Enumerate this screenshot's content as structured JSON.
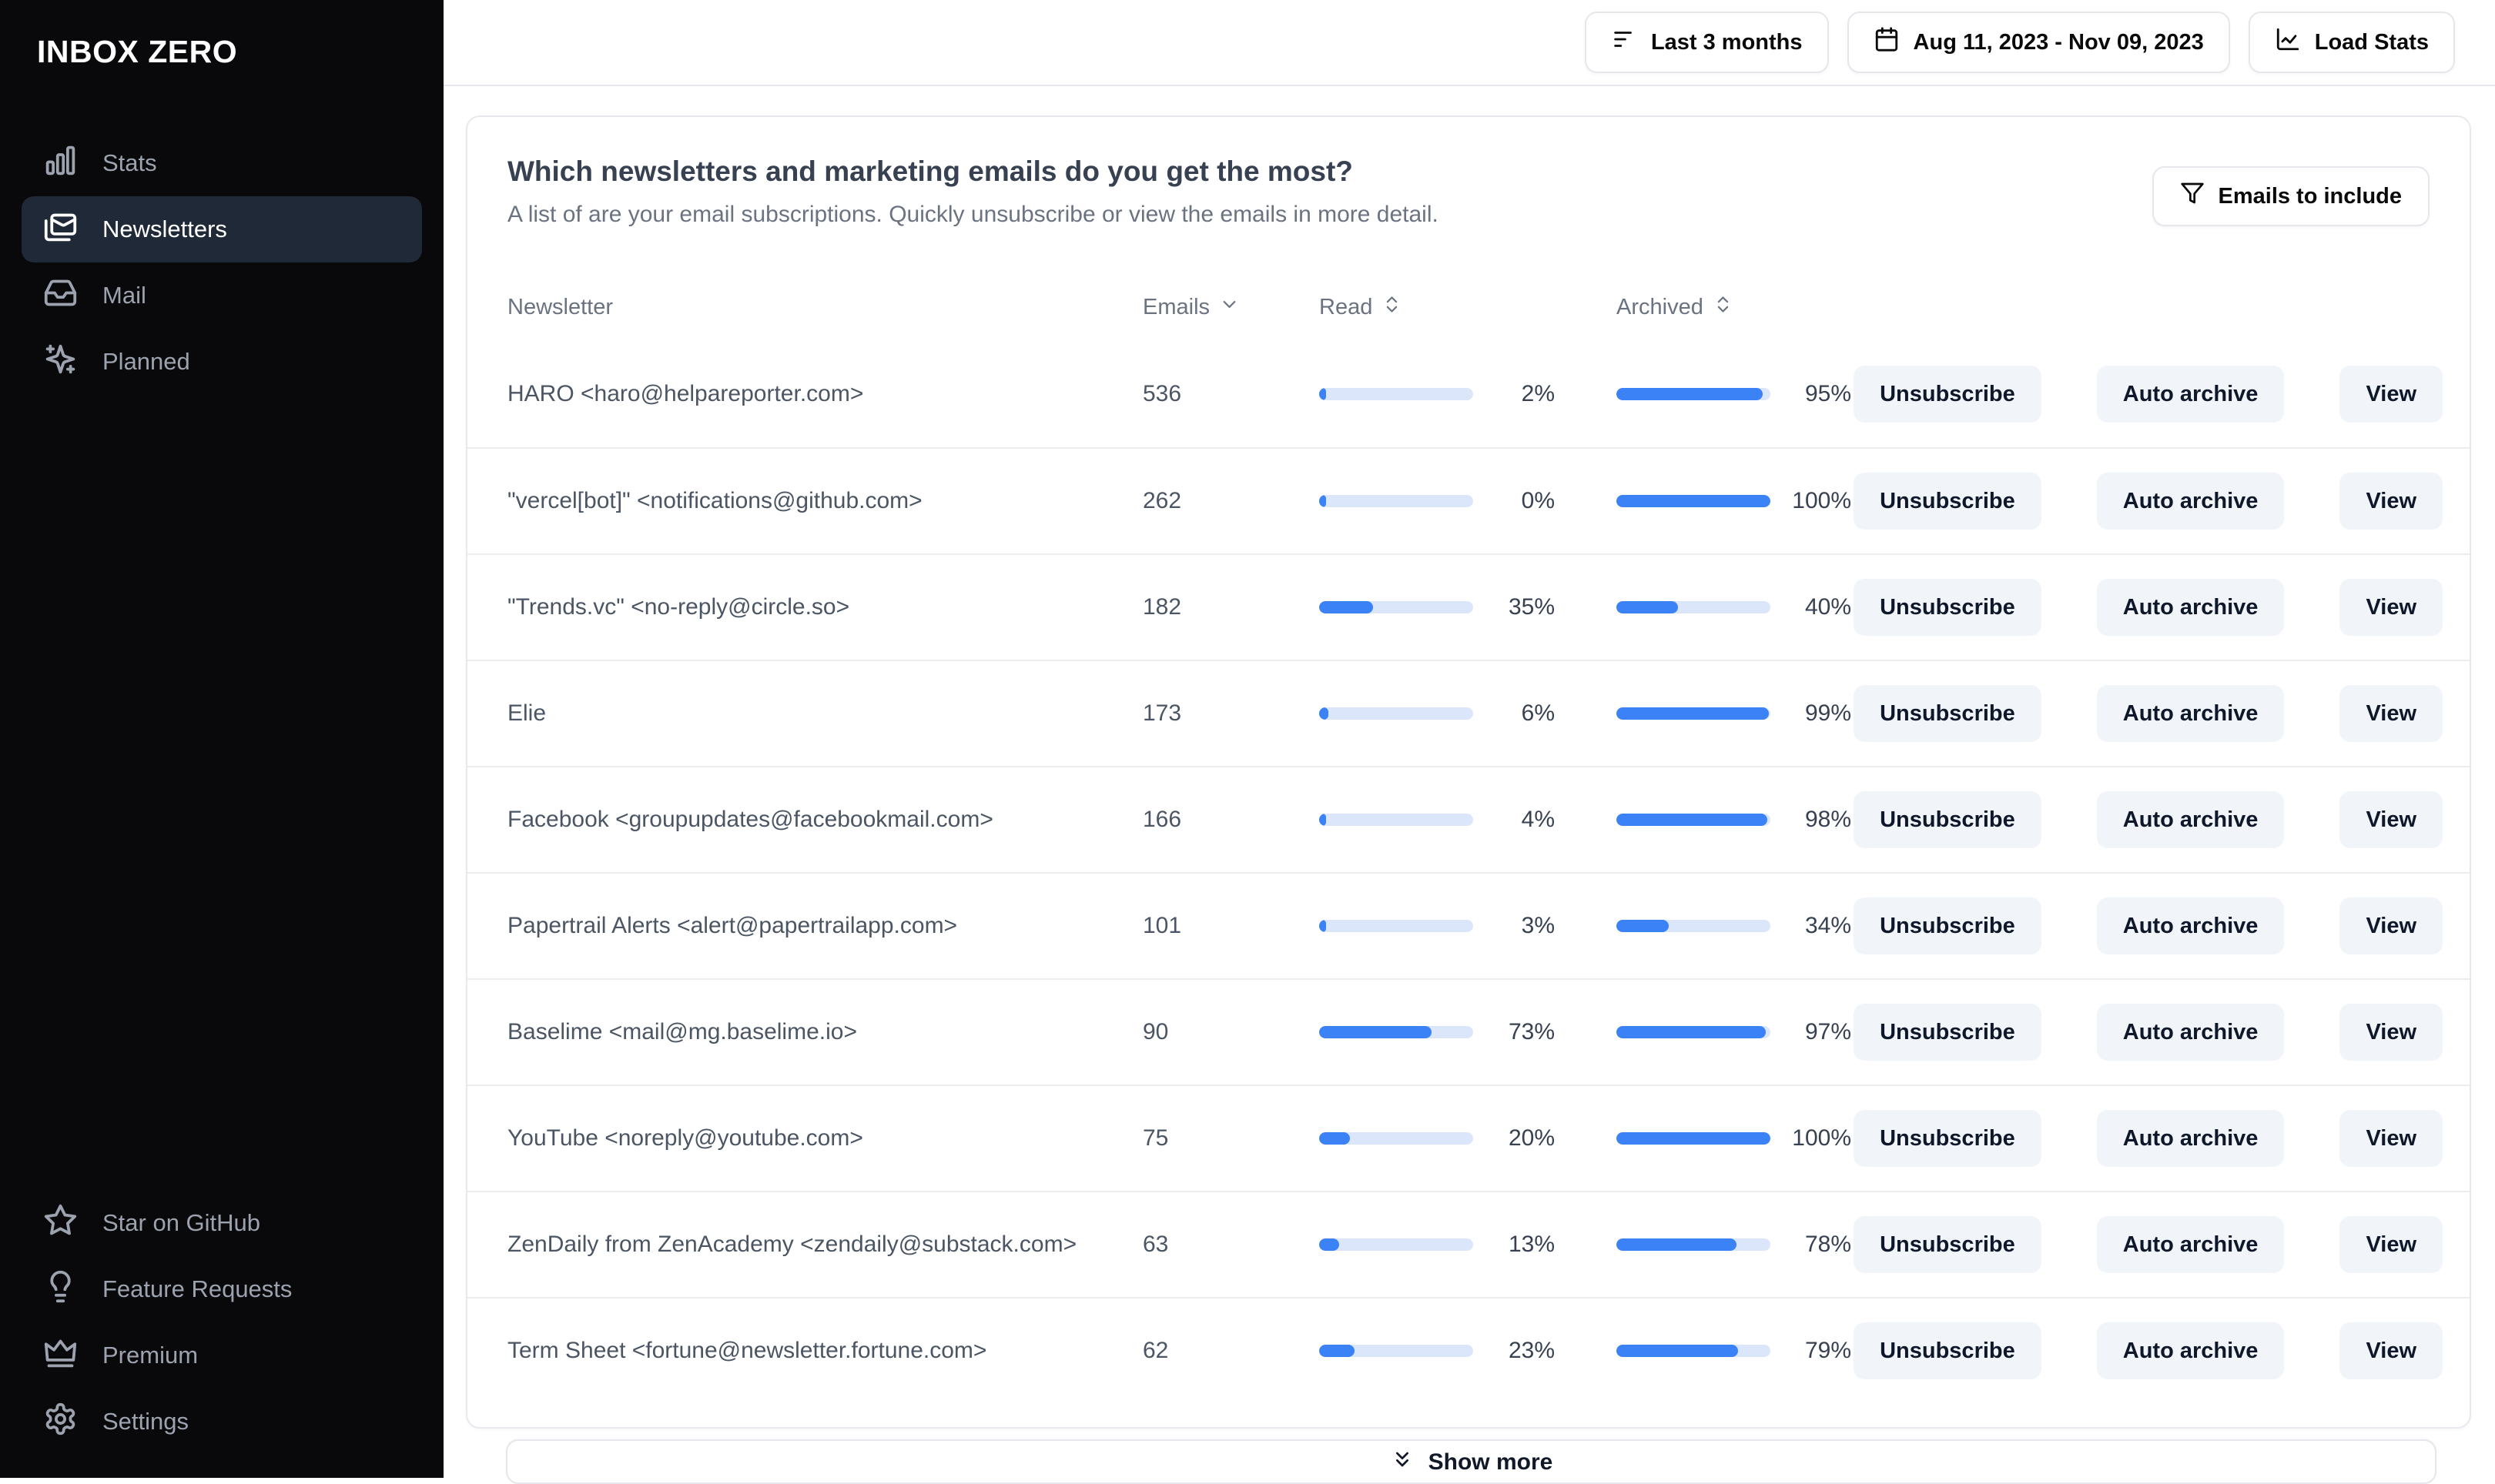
{
  "app": {
    "name": "INBOX ZERO"
  },
  "sidebar": {
    "items": [
      {
        "label": "Stats",
        "icon": "bar-chart-icon",
        "selected": false
      },
      {
        "label": "Newsletters",
        "icon": "mails-icon",
        "selected": true
      },
      {
        "label": "Mail",
        "icon": "inbox-icon",
        "selected": false
      },
      {
        "label": "Planned",
        "icon": "sparkles-icon",
        "selected": false
      }
    ],
    "footer_items": [
      {
        "label": "Star on GitHub",
        "icon": "star-icon"
      },
      {
        "label": "Feature Requests",
        "icon": "lightbulb-icon"
      },
      {
        "label": "Premium",
        "icon": "crown-icon"
      },
      {
        "label": "Settings",
        "icon": "gear-icon"
      }
    ]
  },
  "topbar": {
    "period_button": "Last 3 months",
    "date_range_button": "Aug 11, 2023 - Nov 09, 2023",
    "load_stats_button": "Load Stats"
  },
  "newsletters_card": {
    "title": "Which newsletters and marketing emails do you get the most?",
    "subtitle": "A list of are your email subscriptions. Quickly unsubscribe or view the emails in more detail.",
    "filter_button": "Emails to include",
    "columns": {
      "newsletter": "Newsletter",
      "emails": "Emails",
      "read": "Read",
      "archived": "Archived"
    },
    "actions": {
      "unsubscribe": "Unsubscribe",
      "auto_archive": "Auto archive",
      "view": "View"
    },
    "show_more": "Show more",
    "rows": [
      {
        "name": "HARO <haro@helpareporter.com>",
        "emails": "536",
        "read_pct": 2,
        "read_label": "2%",
        "archived_pct": 95,
        "archived_label": "95%"
      },
      {
        "name": "\"vercel[bot]\" <notifications@github.com>",
        "emails": "262",
        "read_pct": 0,
        "read_label": "0%",
        "archived_pct": 100,
        "archived_label": "100%"
      },
      {
        "name": "\"Trends.vc\" <no-reply@circle.so>",
        "emails": "182",
        "read_pct": 35,
        "read_label": "35%",
        "archived_pct": 40,
        "archived_label": "40%"
      },
      {
        "name": "Elie",
        "emails": "173",
        "read_pct": 6,
        "read_label": "6%",
        "archived_pct": 99,
        "archived_label": "99%"
      },
      {
        "name": "Facebook <groupupdates@facebookmail.com>",
        "emails": "166",
        "read_pct": 4,
        "read_label": "4%",
        "archived_pct": 98,
        "archived_label": "98%"
      },
      {
        "name": "Papertrail Alerts <alert@papertrailapp.com>",
        "emails": "101",
        "read_pct": 3,
        "read_label": "3%",
        "archived_pct": 34,
        "archived_label": "34%"
      },
      {
        "name": "Baselime <mail@mg.baselime.io>",
        "emails": "90",
        "read_pct": 73,
        "read_label": "73%",
        "archived_pct": 97,
        "archived_label": "97%"
      },
      {
        "name": "YouTube <noreply@youtube.com>",
        "emails": "75",
        "read_pct": 20,
        "read_label": "20%",
        "archived_pct": 100,
        "archived_label": "100%"
      },
      {
        "name": "ZenDaily from ZenAcademy <zendaily@substack.com>",
        "emails": "63",
        "read_pct": 13,
        "read_label": "13%",
        "archived_pct": 78,
        "archived_label": "78%"
      },
      {
        "name": "Term Sheet <fortune@newsletter.fortune.com>",
        "emails": "62",
        "read_pct": 23,
        "read_label": "23%",
        "archived_pct": 79,
        "archived_label": "79%"
      }
    ]
  },
  "colors": {
    "accent_blue": "#3b82f6",
    "bar_track": "#dbe6fb",
    "sidebar_bg": "#09090b",
    "sidebar_selected_bg": "#1f2937",
    "button_bg": "#f1f5f9",
    "border": "#e5e7eb"
  }
}
